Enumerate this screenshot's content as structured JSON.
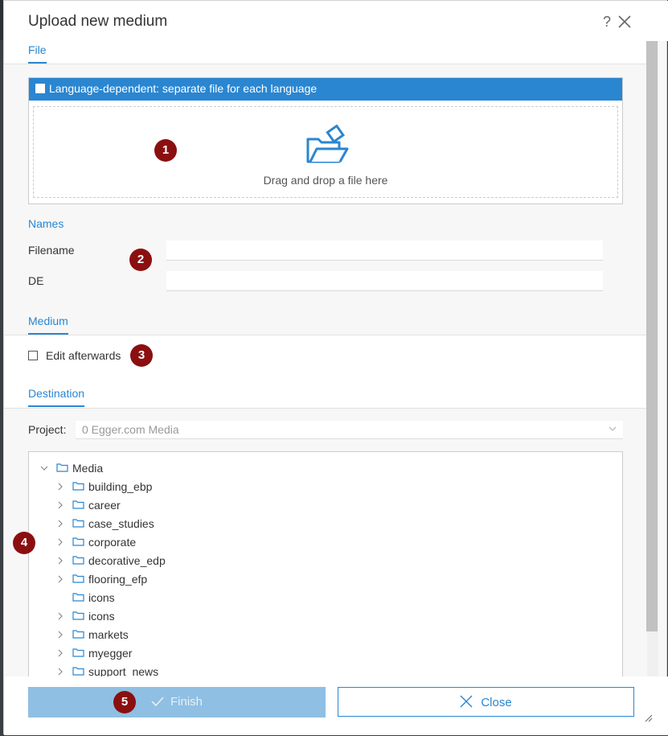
{
  "dialog": {
    "title": "Upload new medium",
    "help_label": "?"
  },
  "tabs": {
    "file": "File",
    "medium": "Medium",
    "destination": "Destination"
  },
  "upload": {
    "language_label": "Language-dependent: separate file for each language",
    "drop_text": "Drag and drop a file here"
  },
  "names": {
    "section": "Names",
    "filename_label": "Filename",
    "filename_value": "",
    "de_label": "DE",
    "de_value": ""
  },
  "medium": {
    "edit_afterwards_label": "Edit afterwards"
  },
  "destination": {
    "project_label": "Project:",
    "project_value": "0 Egger.com Media",
    "tree": {
      "root": "Media",
      "children": [
        {
          "label": "building_ebp",
          "expandable": true
        },
        {
          "label": "career",
          "expandable": true
        },
        {
          "label": "case_studies",
          "expandable": true
        },
        {
          "label": "corporate",
          "expandable": true
        },
        {
          "label": "decorative_edp",
          "expandable": true
        },
        {
          "label": "flooring_efp",
          "expandable": true
        },
        {
          "label": "icons",
          "expandable": false
        },
        {
          "label": "icons",
          "expandable": true
        },
        {
          "label": "markets",
          "expandable": true
        },
        {
          "label": "myegger",
          "expandable": true
        },
        {
          "label": "support_news",
          "expandable": true
        }
      ]
    }
  },
  "footer": {
    "finish_label": "Finish",
    "close_label": "Close"
  },
  "badges": [
    "1",
    "2",
    "3",
    "4",
    "5"
  ],
  "colors": {
    "accent": "#2a86d1",
    "badge": "#8b0f10",
    "finish_disabled": "#8fbfe3"
  },
  "icons": {
    "close": "close-x-icon",
    "folder": "folder-icon",
    "upload": "folder-upload-icon"
  }
}
